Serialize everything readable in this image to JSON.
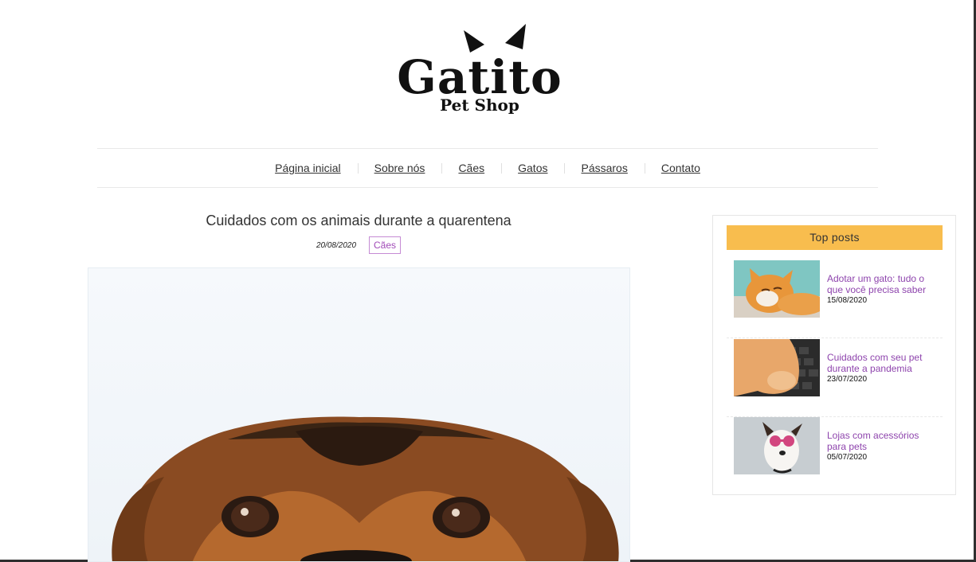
{
  "logo": {
    "main": "Gatito",
    "sub": "Pet Shop"
  },
  "nav": {
    "items": [
      "Página inicial",
      "Sobre nós",
      "Cães",
      "Gatos",
      "Pássaros",
      "Contato"
    ]
  },
  "post": {
    "title": "Cuidados com os animais durante a quarentena",
    "date": "20/08/2020",
    "category": "Cães"
  },
  "sidebar": {
    "header": "Top posts",
    "items": [
      {
        "title": "Adotar um gato: tudo o que você precisa saber",
        "date": "15/08/2020"
      },
      {
        "title": "Cuidados com seu pet durante a pandemia",
        "date": "23/07/2020"
      },
      {
        "title": "Lojas com acessórios para pets",
        "date": "05/07/2020"
      }
    ]
  },
  "colors": {
    "accent": "#f8bd4e",
    "link": "#8e44ad"
  }
}
